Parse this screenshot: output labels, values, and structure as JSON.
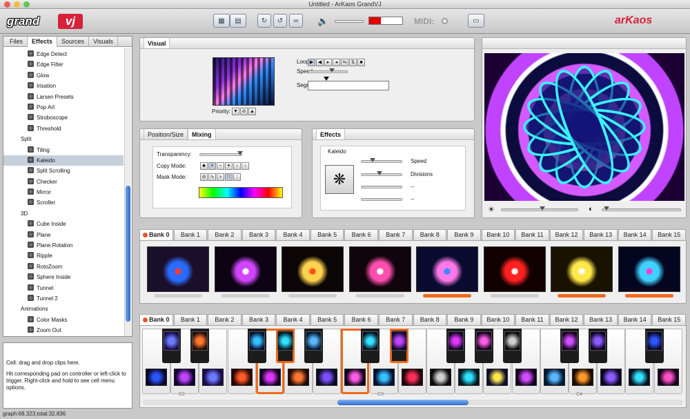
{
  "window": {
    "title": "Untitled - ArKaos GrandVJ",
    "traffic_colors": [
      "#ed5d5a",
      "#f4bc3a",
      "#63c454"
    ]
  },
  "toolbar": {
    "logo_left": "grand",
    "logo_right": "vj",
    "midi_label": "MIDI:",
    "brand": "arKaos",
    "meter_level": 0.36,
    "buttons": [
      {
        "name": "layout-single-icon"
      },
      {
        "name": "layout-split-icon"
      },
      {
        "name": "sync-icon"
      },
      {
        "name": "refresh-icon"
      },
      {
        "name": "link-icon"
      },
      {
        "name": "fullscreen-icon"
      }
    ]
  },
  "sidebar": {
    "tabs": [
      "Files",
      "Effects",
      "Sources",
      "Visuals"
    ],
    "active_tab": "Effects",
    "tree": [
      {
        "label": "Edge Detect",
        "type": "item"
      },
      {
        "label": "Edge Filter",
        "type": "item"
      },
      {
        "label": "Glow",
        "type": "item"
      },
      {
        "label": "Irisation",
        "type": "item"
      },
      {
        "label": "Larsen Presets",
        "type": "item"
      },
      {
        "label": "Pop Art",
        "type": "item"
      },
      {
        "label": "Stroboscope",
        "type": "item"
      },
      {
        "label": "Threshold",
        "type": "item"
      },
      {
        "label": "Split",
        "type": "category"
      },
      {
        "label": "Tiling",
        "type": "item"
      },
      {
        "label": "Kaleido",
        "type": "item",
        "selected": true
      },
      {
        "label": "Split Scrolling",
        "type": "item"
      },
      {
        "label": "Checker",
        "type": "item"
      },
      {
        "label": "Mirror",
        "type": "item"
      },
      {
        "label": "Scroller",
        "type": "item"
      },
      {
        "label": "3D",
        "type": "category"
      },
      {
        "label": "Cube Inside",
        "type": "item"
      },
      {
        "label": "Plane",
        "type": "item"
      },
      {
        "label": "Plane Rotation",
        "type": "item"
      },
      {
        "label": "Ripple",
        "type": "item"
      },
      {
        "label": "RotoZoom",
        "type": "item"
      },
      {
        "label": "Sphere Inside",
        "type": "item"
      },
      {
        "label": "Tunnel",
        "type": "item"
      },
      {
        "label": "Tunnel 2",
        "type": "item"
      },
      {
        "label": "Animations",
        "type": "category"
      },
      {
        "label": "Color Masks",
        "type": "item"
      },
      {
        "label": "Zoom Out",
        "type": "item"
      }
    ]
  },
  "help": {
    "line1": "Cell: drag and drop clips here.",
    "line2": "Hit corresponding pad on controller or left-click to trigger.  Right-click and hold to see cell menu options."
  },
  "status": "graph:68.323,total:32.836",
  "visual_panel": {
    "tab": "Visual",
    "loop_label": "Loop:",
    "speed_label": "Speed",
    "segment_label": "Segment:",
    "priority_label": "Priority:"
  },
  "position_panel": {
    "tabs": [
      "Position/Size",
      "Mixing"
    ],
    "active_tab": "Mixing",
    "transparency_label": "Transparency:",
    "copy_mode_label": "Copy Mode:",
    "mask_mode_label": "Mask Mode:"
  },
  "effects_panel": {
    "tab": "Effects",
    "effect_name": "Kaleido",
    "params": [
      "Speed",
      "Divisions",
      "--",
      "--"
    ]
  },
  "banks": [
    "Bank 0",
    "Bank 1",
    "Bank 2",
    "Bank 3",
    "Bank 4",
    "Bank 5",
    "Bank 6",
    "Bank 7",
    "Bank 8",
    "Bank 9",
    "Bank 10",
    "Bank 11",
    "Bank 12",
    "Bank 13",
    "Bank 14",
    "Bank 15"
  ],
  "active_bank": "Bank 0",
  "clips": [
    {
      "active": false,
      "colors": [
        "#1a0f2b",
        "#2a6bff",
        "#ff3a2a"
      ]
    },
    {
      "active": false,
      "colors": [
        "#0d0314",
        "#d145ff",
        "#ffffff"
      ]
    },
    {
      "active": false,
      "colors": [
        "#0b0605",
        "#ffd34d",
        "#ff4a1a"
      ]
    },
    {
      "active": false,
      "colors": [
        "#12040c",
        "#ff4fb0",
        "#ffffff"
      ]
    },
    {
      "active": true,
      "colors": [
        "#0a0b30",
        "#ff79e8",
        "#2f8cff"
      ]
    },
    {
      "active": false,
      "colors": [
        "#120101",
        "#ff2020",
        "#ffffff"
      ]
    },
    {
      "active": true,
      "colors": [
        "#1a1200",
        "#ffe84a",
        "#ffffff"
      ]
    },
    {
      "active": true,
      "colors": [
        "#040620",
        "#3fd2ff",
        "#ff3cd2"
      ]
    }
  ],
  "octaves": [
    "C2",
    "C3",
    "C4"
  ]
}
